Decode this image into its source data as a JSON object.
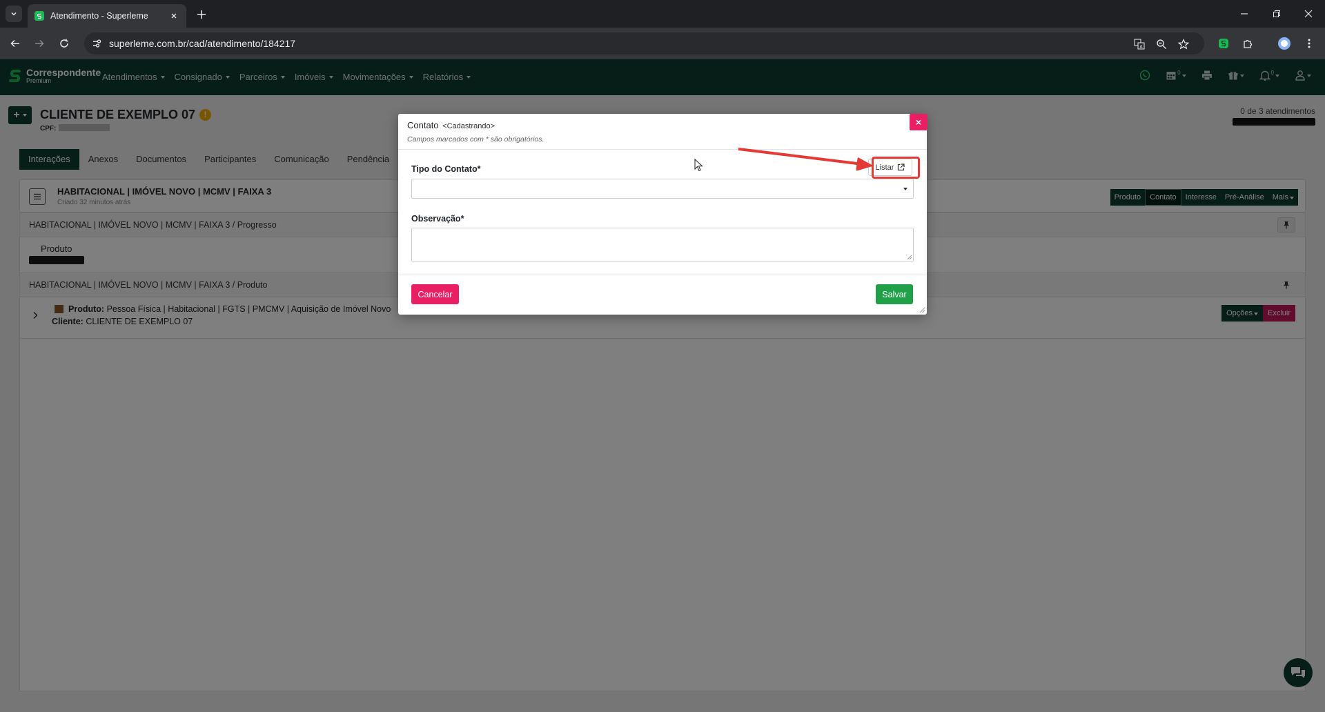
{
  "browser": {
    "tab_title": "Atendimento - Superleme",
    "url": "superleme.com.br/cad/atendimento/184217"
  },
  "app": {
    "brand": {
      "title": "Correspondente",
      "subtitle": "Premium"
    },
    "menu": [
      {
        "label": "Atendimentos"
      },
      {
        "label": "Consignado"
      },
      {
        "label": "Parceiros"
      },
      {
        "label": "Imóveis"
      },
      {
        "label": "Movimentações"
      },
      {
        "label": "Relatórios"
      }
    ],
    "nav_badges": {
      "calendar": "0",
      "notifications": "0"
    }
  },
  "page": {
    "client_title": "CLIENTE DE EXEMPLO 07",
    "cpf_label": "CPF:",
    "counter": "0 de 3 atendimentos",
    "tabs": [
      "Interações",
      "Anexos",
      "Documentos",
      "Participantes",
      "Comunicação",
      "Pendência"
    ]
  },
  "card": {
    "title": "HABITACIONAL | IMÓVEL NOVO | MCMV | FAIXA 3",
    "subtitle": "Criado 32 minutos atrás",
    "actions": [
      "Produto",
      "Contato",
      "Interesse",
      "Pré-Análise",
      "Mais"
    ],
    "row_progress": "HABITACIONAL | IMÓVEL NOVO | MCMV | FAIXA 3  /  Progresso",
    "produto_label": "Produto",
    "row_produto": "HABITACIONAL | IMÓVEL NOVO | MCMV | FAIXA 3  /  Produto",
    "product_label": "Produto:",
    "product_value": "Pessoa Física | Habitacional | FGTS | PMCMV | Aquisição de Imóvel Novo",
    "client_label": "Cliente:",
    "client_value": "CLIENTE DE EXEMPLO 07",
    "options_btn": "Opções",
    "delete_btn": "Excluir"
  },
  "modal": {
    "title": "Contato",
    "state": "<Cadastrando>",
    "hint": "Campos marcados com * são obrigatórios.",
    "close": "×",
    "field_tipo_label": "Tipo do Contato*",
    "listar_label": "Listar",
    "field_obs_label": "Observação*",
    "tipo_value": "",
    "obs_value": "",
    "cancel_label": "Cancelar",
    "save_label": "Salvar"
  },
  "colors": {
    "brand_dark": "#0f3d30",
    "danger": "#e91e63",
    "success": "#1fa049",
    "annotation": "#e53935"
  }
}
